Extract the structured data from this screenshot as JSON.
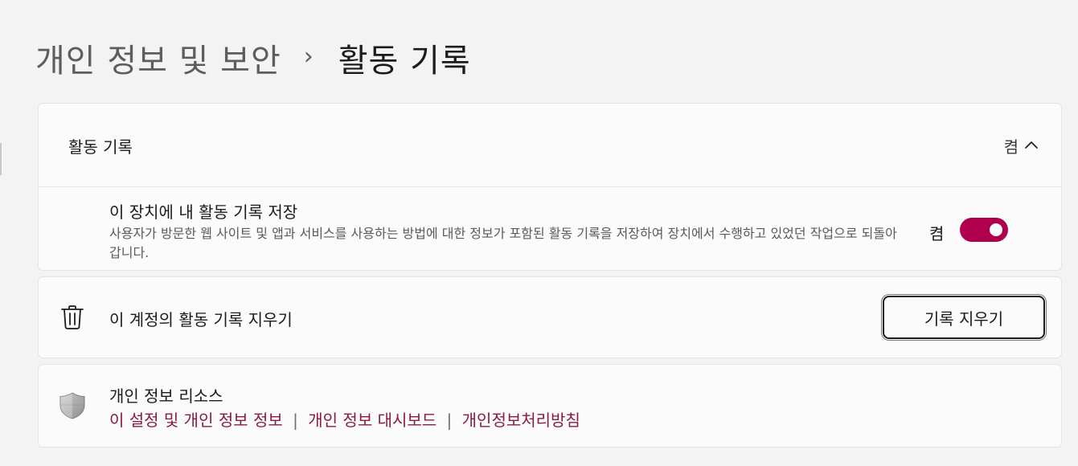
{
  "breadcrumb": {
    "parent": "개인 정보 및 보안",
    "separator": "›",
    "current": "활동 기록"
  },
  "activity_history": {
    "header_title": "활동 기록",
    "header_status": "켬",
    "expand_icon": "chevron-up-icon",
    "store_setting": {
      "title": "이 장치에 내 활동 기록 저장",
      "description": "사용자가 방문한 웹 사이트 및 앱과 서비스를 사용하는 방법에 대한 정보가 포함된 활동 기록을 저장하여 장치에서 수행하고 있었던 작업으로 되돌아갑니다.",
      "toggle_label": "켬",
      "toggle_on": true
    }
  },
  "clear_history": {
    "icon": "trash-icon",
    "label": "이 계정의 활동 기록 지우기",
    "button_label": "기록 지우기"
  },
  "privacy_resources": {
    "icon": "shield-icon",
    "title": "개인 정보 리소스",
    "links": [
      "이 설정 및 개인 정보 정보",
      "개인 정보 대시보드",
      "개인정보처리방침"
    ],
    "link_separator": "|"
  },
  "colors": {
    "accent": "#b0004d",
    "link": "#8a1a3f",
    "background": "#f3f3f3",
    "card": "#fbfbfb"
  }
}
